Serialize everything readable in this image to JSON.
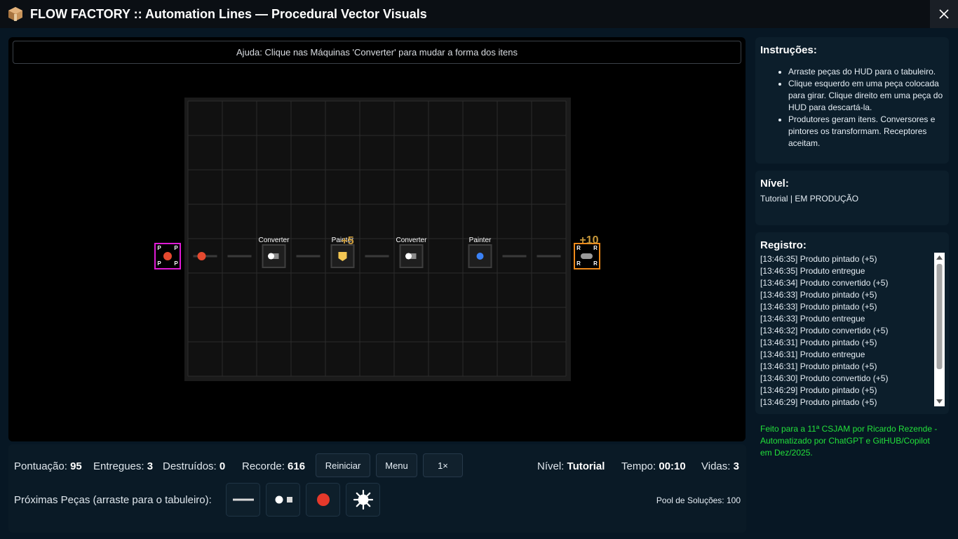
{
  "window": {
    "title": "FLOW FACTORY :: Automation Lines — Procedural Vector Visuals",
    "icon": "package-icon",
    "close_icon": "close-icon"
  },
  "game": {
    "help_text": "Ajuda: Clique nas Máquinas 'Converter' para mudar a forma dos itens",
    "grid": {
      "cols": 11,
      "rows": 8
    },
    "producer": {
      "corner_label": "P",
      "item_color": "#e5492f"
    },
    "receiver": {
      "corner_label": "R",
      "score_popup": "+10"
    },
    "machines": [
      {
        "label": "Converter",
        "popup": ""
      },
      {
        "label": "Painter",
        "popup": "+5"
      },
      {
        "label": "Converter",
        "popup": ""
      },
      {
        "label": "Painter",
        "popup": ""
      }
    ],
    "colors": {
      "producer_border": "#e01ad6",
      "receiver_border": "#ef8a1a",
      "item_red": "#e5492f",
      "item_yellow": "#f3c653",
      "item_blue": "#3b82f6",
      "popup_gold": "#c99a3c"
    }
  },
  "hud": {
    "score_label": "Pontuação:",
    "score_value": "95",
    "delivered_label": "Entregues:",
    "delivered_value": "3",
    "destroyed_label": "Destruídos:",
    "destroyed_value": "0",
    "record_label": "Recorde:",
    "record_value": "616",
    "restart_button": "Reiniciar",
    "menu_button": "Menu",
    "speed_button": "1×",
    "level_label": "Nível:",
    "level_value": "Tutorial",
    "time_label": "Tempo:",
    "time_value": "00:10",
    "lives_label": "Vidas:",
    "lives_value": "3",
    "next_pieces_label": "Próximas Peças (arraste para o tabuleiro):",
    "next_pieces": [
      "conveyor-icon",
      "converter-icon",
      "producer-icon",
      "painter-icon"
    ],
    "pool_label": "Pool de Soluções: 100"
  },
  "instructions": {
    "title": "Instruções:",
    "items": [
      "Arraste peças do HUD para o tabuleiro.",
      "Clique esquerdo em uma peça colocada para girar. Clique direito em uma peça do HUD para descartá-la.",
      "Produtores geram itens. Conversores e pintores os transformam. Receptores aceitam."
    ]
  },
  "level": {
    "title": "Nível:",
    "value": "Tutorial | EM PRODUÇÃO"
  },
  "log": {
    "title": "Registro:",
    "entries": [
      "[13:46:35] Produto pintado (+5)",
      "[13:46:35] Produto entregue",
      "[13:46:34] Produto convertido (+5)",
      "[13:46:33] Produto pintado (+5)",
      "[13:46:33] Produto pintado (+5)",
      "[13:46:33] Produto entregue",
      "[13:46:32] Produto convertido (+5)",
      "[13:46:31] Produto pintado (+5)",
      "[13:46:31] Produto entregue",
      "[13:46:31] Produto pintado (+5)",
      "[13:46:30] Produto convertido (+5)",
      "[13:46:29] Produto pintado (+5)",
      "[13:46:29] Produto pintado (+5)"
    ]
  },
  "credits": "Feito para a 11ª CSJAM por Ricardo Rezende - Automatizado por ChatGPT e GitHUB/Copilot em Dez/2025."
}
